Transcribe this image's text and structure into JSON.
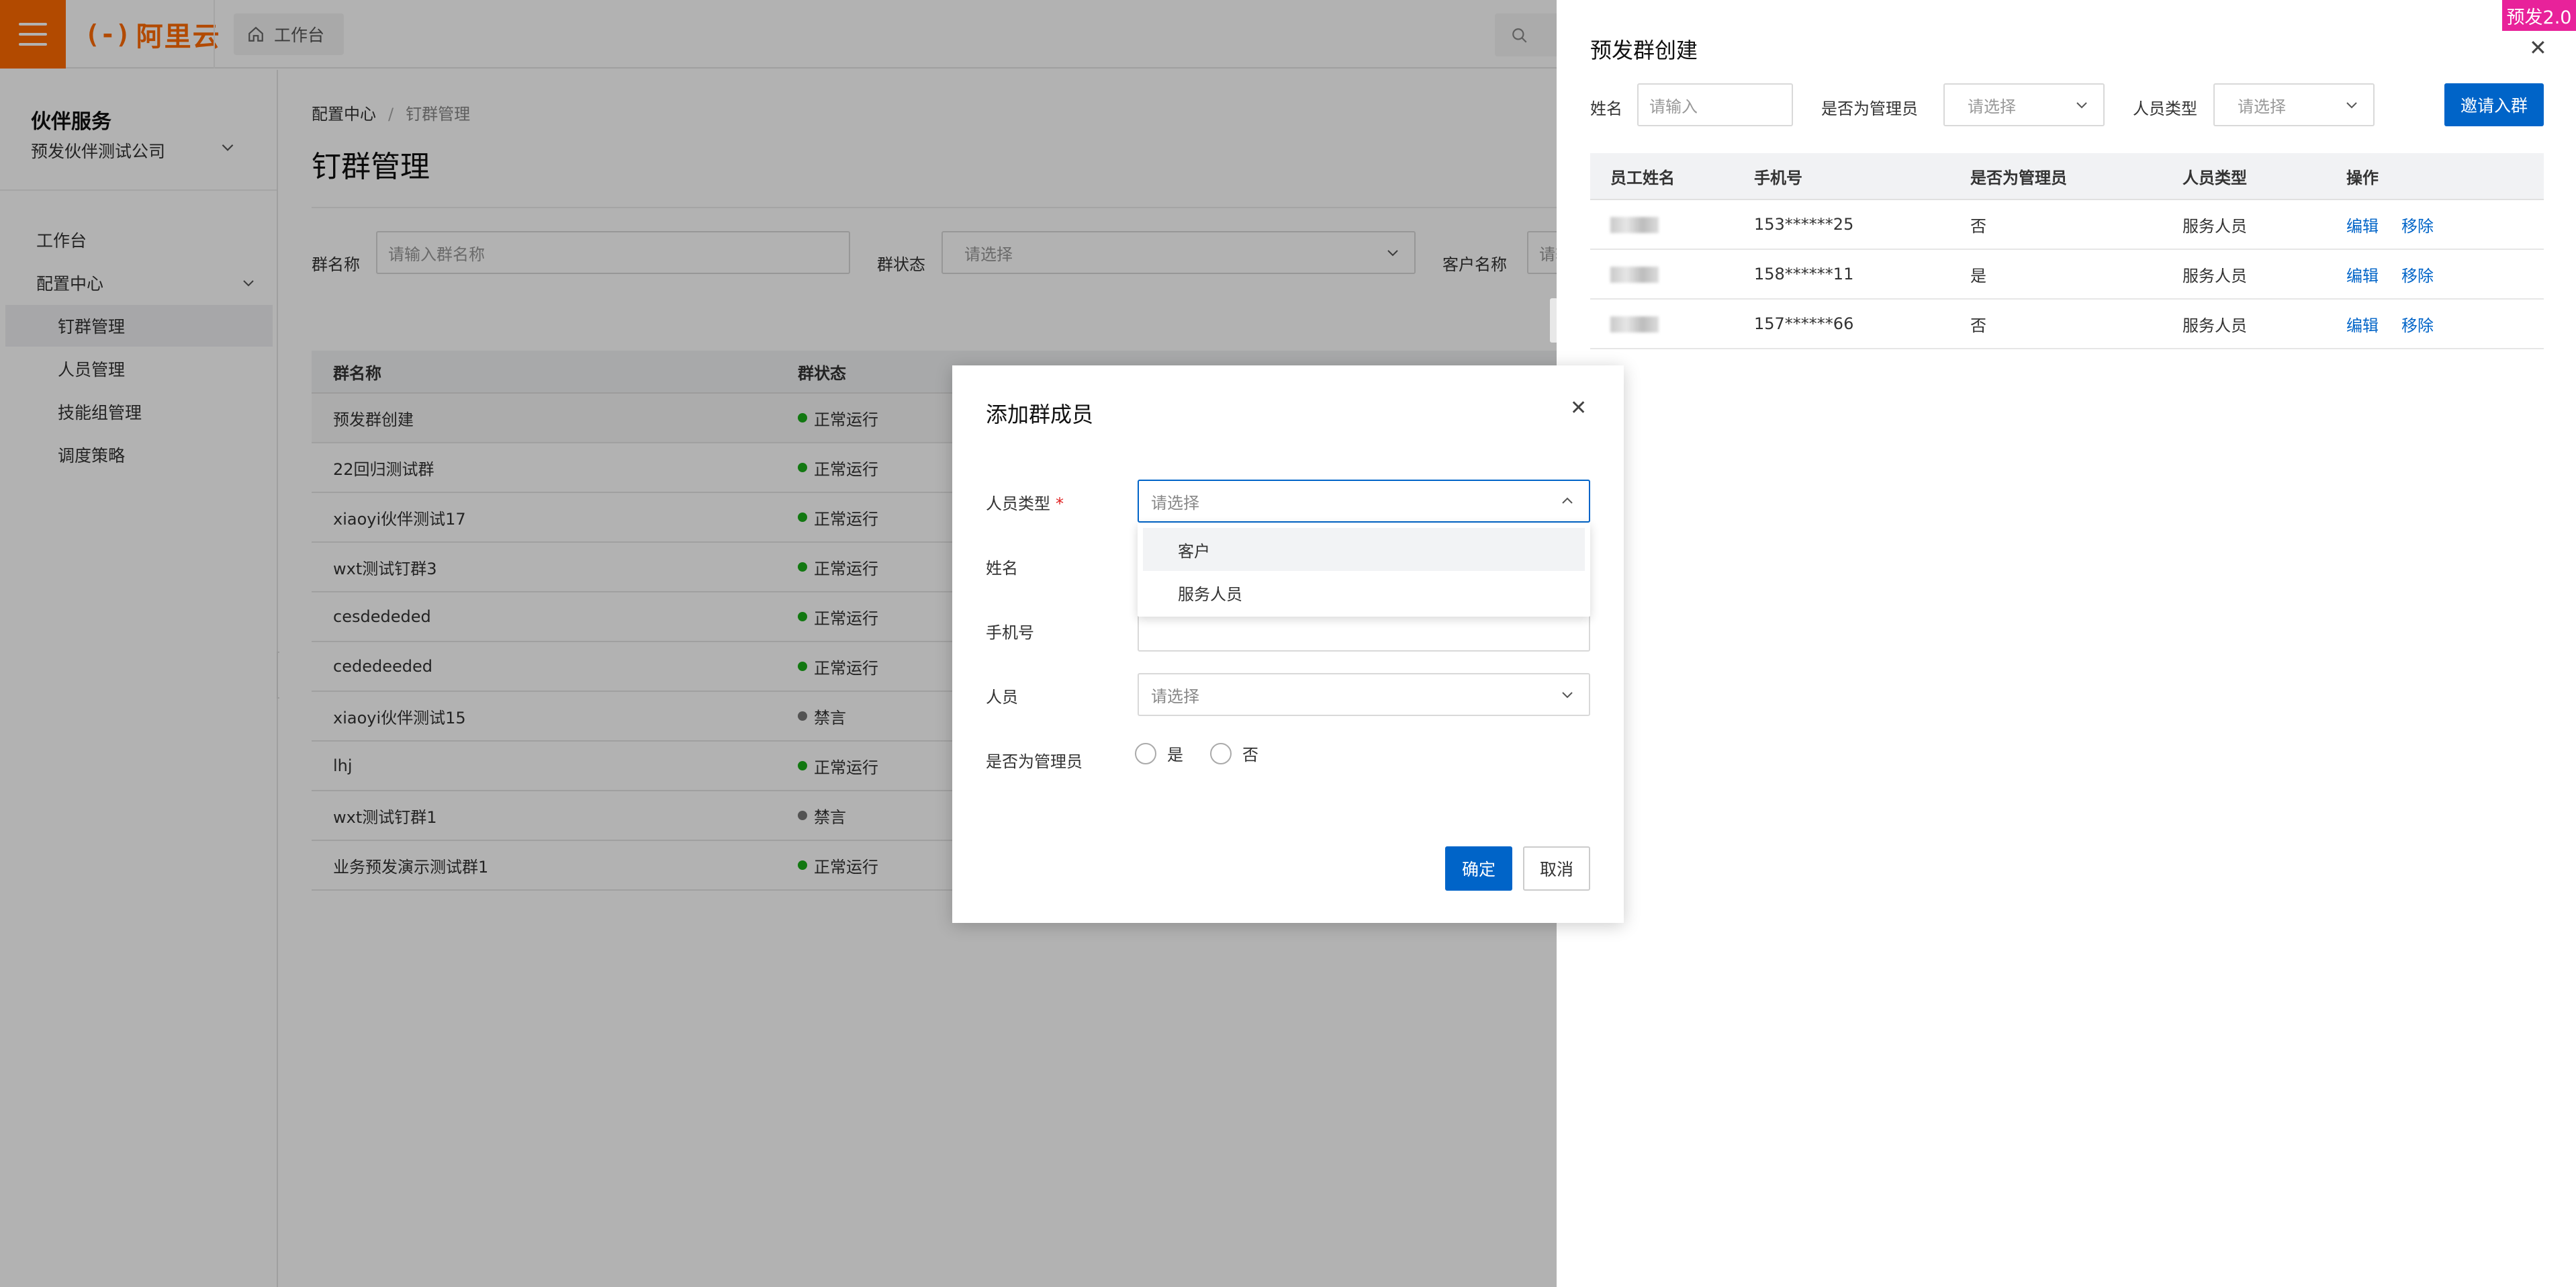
{
  "header": {
    "logo_mark": "(-)",
    "logo_text": "阿里云",
    "workbench": "工作台",
    "search_placeholder": "搜"
  },
  "sidebar": {
    "title": "伙伴服务",
    "company": "预发伙伴测试公司",
    "items": [
      {
        "label": "工作台"
      },
      {
        "label": "配置中心"
      },
      {
        "label": "钉群管理"
      },
      {
        "label": "人员管理"
      },
      {
        "label": "技能组管理"
      },
      {
        "label": "调度策略"
      }
    ]
  },
  "main": {
    "breadcrumb": [
      "配置中心",
      "/",
      "钉群管理"
    ],
    "title": "钉群管理",
    "filters": {
      "group_name_label": "群名称",
      "group_name_placeholder": "请输入群名称",
      "status_label": "群状态",
      "status_placeholder": "请选择",
      "customer_label": "客户名称",
      "customer_placeholder": "请输"
    },
    "table": {
      "headers": [
        "群名称",
        "群状态"
      ],
      "rows": [
        {
          "name": "预发群创建",
          "status": "正常运行",
          "status_color": "#1aad19"
        },
        {
          "name": "22回归测试群",
          "status": "正常运行",
          "status_color": "#1aad19"
        },
        {
          "name": "xiaoyi伙伴测试17",
          "status": "正常运行",
          "status_color": "#1aad19"
        },
        {
          "name": "wxt测试钉群3",
          "status": "正常运行",
          "status_color": "#1aad19"
        },
        {
          "name": "cesdededed",
          "status": "正常运行",
          "status_color": "#1aad19"
        },
        {
          "name": "cededeeded",
          "status": "正常运行",
          "status_color": "#1aad19"
        },
        {
          "name": "xiaoyi伙伴测试15",
          "status": "禁言",
          "status_color": "#777777"
        },
        {
          "name": "lhj",
          "status": "正常运行",
          "status_color": "#1aad19"
        },
        {
          "name": "wxt测试钉群1",
          "status": "禁言",
          "status_color": "#777777"
        },
        {
          "name": "业务预发演示测试群1",
          "status": "正常运行",
          "status_color": "#1aad19"
        }
      ]
    }
  },
  "drawer": {
    "title": "预发群创建",
    "env_badge": "预发2.0",
    "filters": {
      "name_label": "姓名",
      "name_placeholder": "请输入",
      "admin_label": "是否为管理员",
      "admin_placeholder": "请选择",
      "type_label": "人员类型",
      "type_placeholder": "请选择"
    },
    "invite_button": "邀请入群",
    "table": {
      "headers": [
        "员工姓名",
        "手机号",
        "是否为管理员",
        "人员类型",
        "操作"
      ],
      "rows": [
        {
          "phone": "153******25",
          "admin": "否",
          "type": "服务人员",
          "edit": "编辑",
          "remove": "移除"
        },
        {
          "phone": "158******11",
          "admin": "是",
          "type": "服务人员",
          "edit": "编辑",
          "remove": "移除"
        },
        {
          "phone": "157******66",
          "admin": "否",
          "type": "服务人员",
          "edit": "编辑",
          "remove": "移除"
        }
      ]
    }
  },
  "modal": {
    "title": "添加群成员",
    "fields": {
      "type_label": "人员类型",
      "required_mark": "*",
      "type_placeholder": "请选择",
      "name_label": "姓名",
      "phone_label": "手机号",
      "person_label": "人员",
      "person_placeholder": "请选择",
      "admin_label": "是否为管理员",
      "admin_yes": "是",
      "admin_no": "否"
    },
    "dropdown_options": [
      "客户",
      "服务人员"
    ],
    "ok_button": "确定",
    "cancel_button": "取消"
  },
  "colors": {
    "brand": "#ff6a00",
    "primary": "#0064c8",
    "env_badge": "#e8229a"
  }
}
